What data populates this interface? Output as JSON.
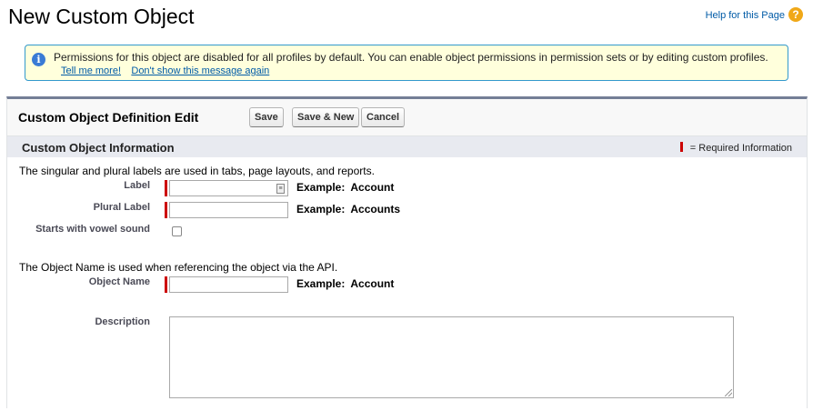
{
  "page": {
    "title": "New Custom Object",
    "help_link": "Help for this Page",
    "help_icon": "question-circle-icon"
  },
  "info_message": {
    "text": "Permissions for this object are disabled for all profiles by default. You can enable object permissions in permission sets or by editing custom profiles.",
    "tell_me_more": "Tell me more!",
    "dont_show": "Don't show this message again",
    "icon": "info-circle-icon"
  },
  "panel": {
    "title": "Custom Object Definition Edit",
    "buttons": {
      "save": "Save",
      "save_new": "Save & New",
      "cancel": "Cancel"
    }
  },
  "section": {
    "title": "Custom Object Information",
    "required_legend": "= Required Information"
  },
  "form": {
    "labels_description": "The singular and plural labels are used in tabs, page layouts, and reports.",
    "label": {
      "label": "Label",
      "value": "",
      "example_prefix": "Example:",
      "example_value": "Account"
    },
    "plural_label": {
      "label": "Plural Label",
      "value": "",
      "example_prefix": "Example:",
      "example_value": "Accounts"
    },
    "vowel_sound": {
      "label": "Starts with vowel sound",
      "checked": false
    },
    "object_name_description": "The Object Name is used when referencing the object via the API.",
    "object_name": {
      "label": "Object Name",
      "value": "",
      "example_prefix": "Example:",
      "example_value": "Account"
    },
    "description": {
      "label": "Description",
      "value": ""
    }
  },
  "colors": {
    "link": "#015ba7",
    "required": "#cc0000",
    "info_bg": "#ffffdc",
    "info_border": "#3399cc",
    "section_bg": "#e8eaf0"
  }
}
